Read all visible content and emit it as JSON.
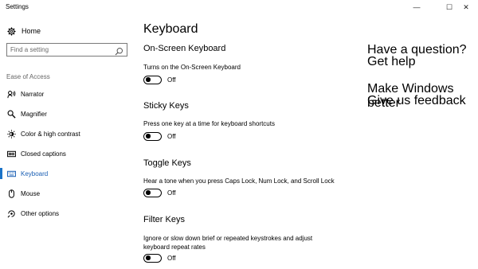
{
  "window": {
    "title": "Settings",
    "minimize_glyph": "—",
    "maximize_glyph": "☐",
    "close_glyph": "✕"
  },
  "sidebar": {
    "home_label": "Home",
    "search_placeholder": "Find a setting",
    "section_label": "Ease of Access",
    "items": [
      {
        "label": "Narrator",
        "icon": "narrator-icon",
        "active": false
      },
      {
        "label": "Magnifier",
        "icon": "magnifier-icon",
        "active": false
      },
      {
        "label": "Color & high contrast",
        "icon": "color-contrast-icon",
        "active": false
      },
      {
        "label": "Closed captions",
        "icon": "closed-captions-icon",
        "active": false
      },
      {
        "label": "Keyboard",
        "icon": "keyboard-icon",
        "active": true
      },
      {
        "label": "Mouse",
        "icon": "mouse-icon",
        "active": false
      },
      {
        "label": "Other options",
        "icon": "other-options-icon",
        "active": false
      }
    ]
  },
  "main": {
    "title": "Keyboard",
    "groups": [
      {
        "heading": "On-Screen Keyboard",
        "description": "Turns on the On-Screen Keyboard",
        "toggle_state": "Off"
      },
      {
        "heading": "Sticky Keys",
        "description": "Press one key at a time for keyboard shortcuts",
        "toggle_state": "Off"
      },
      {
        "heading": "Toggle Keys",
        "description": "Hear a tone when you press Caps Lock, Num Lock, and Scroll Lock",
        "toggle_state": "Off"
      },
      {
        "heading": "Filter Keys",
        "description_line1": "Ignore or slow down brief or repeated keystrokes and adjust",
        "description_line2": "keyboard repeat rates",
        "toggle_state": "Off"
      }
    ]
  },
  "right_pane": {
    "question": "Have a question?",
    "get_help": "Get help",
    "make_better": "Make Windows better",
    "feedback": "Give us feedback"
  },
  "colors": {
    "accent": "#1a73c8",
    "link": "#0b63c4"
  }
}
